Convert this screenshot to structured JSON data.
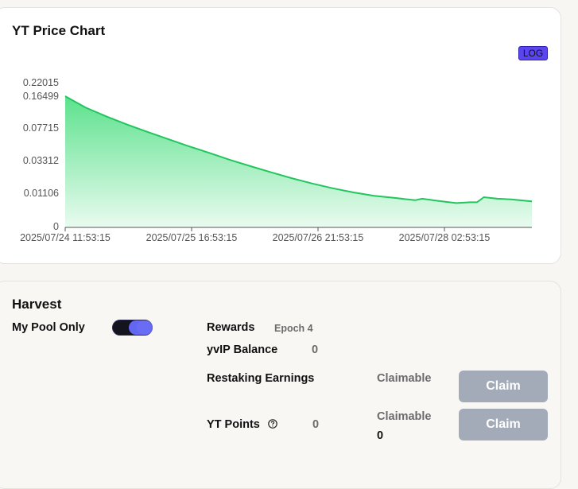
{
  "chart_section": {
    "title": "YT Price Chart",
    "log_label": "LOG"
  },
  "chart_data": {
    "type": "area",
    "title": "YT Price Chart",
    "scale": "log",
    "y_ticks": [
      "0.22015",
      "0.16499",
      "0.07715",
      "0.03312",
      "0.01106",
      "0"
    ],
    "x_ticks": [
      "2025/07/24 11:53:15",
      "2025/07/25 16:53:15",
      "2025/07/26 21:53:15",
      "2025/07/28 02:53:15"
    ],
    "x_unit": "hours since 2025/07/24 11:53:15",
    "x": [
      0,
      6,
      12,
      18,
      24,
      30,
      36,
      42,
      48,
      54,
      60,
      66,
      72,
      78,
      84,
      90,
      96,
      102,
      104,
      108,
      112,
      114,
      118,
      120,
      122,
      126,
      130,
      136
    ],
    "y": [
      0.165,
      0.12,
      0.094,
      0.075,
      0.061,
      0.05,
      0.041,
      0.034,
      0.028,
      0.0235,
      0.0198,
      0.0168,
      0.0145,
      0.0127,
      0.0113,
      0.0103,
      0.0097,
      0.0091,
      0.0095,
      0.009,
      0.0086,
      0.0084,
      0.0086,
      0.0086,
      0.0099,
      0.0095,
      0.0093,
      0.0088
    ],
    "color": "#22c55e",
    "grid": false
  },
  "harvest": {
    "title": "Harvest",
    "my_pool_only_label": "My Pool Only",
    "my_pool_only_on": true,
    "rewards_label": "Rewards",
    "epoch_label": "Epoch 4",
    "yvip_label": "yvIP Balance",
    "yvip_value": "0",
    "restaking_label": "Restaking Earnings",
    "restaking_claimable_label": "Claimable",
    "claim_label": "Claim",
    "yt_points_label": "YT Points",
    "yt_points_value": "0",
    "yt_claimable_label": "Claimable",
    "yt_claimable_value": "0",
    "toggle_color": "#6366f1",
    "claim_button_color": "#a3aab8"
  }
}
